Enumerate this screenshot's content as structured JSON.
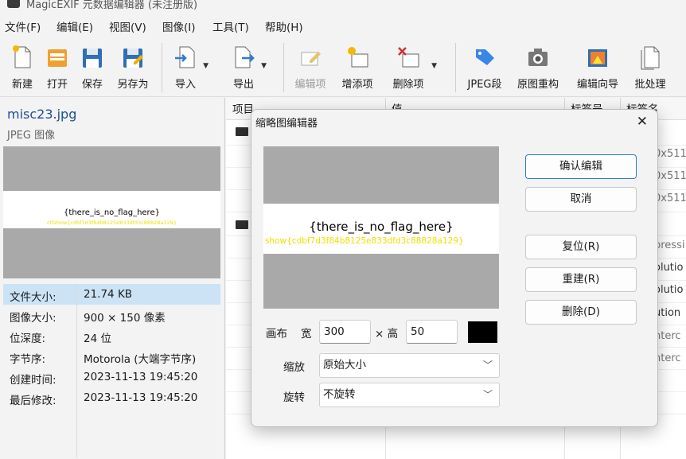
{
  "app": {
    "title": "MagicEXIF 元数据编辑器 (未注册版)"
  },
  "menu": [
    "文件(F)",
    "编辑(E)",
    "视图(V)",
    "图像(I)",
    "工具(T)",
    "帮助(H)"
  ],
  "toolbar": {
    "new": "新建",
    "open": "打开",
    "save": "保存",
    "save_as": "另存为",
    "import": "导入",
    "export": "导出",
    "edit_item": "编辑项",
    "add_item": "增添项",
    "delete_item": "删除项",
    "jpeg_segment": "JPEG段",
    "rebuild_image": "原图重构",
    "edit_wizard": "编辑向导",
    "batch": "批处理"
  },
  "file": {
    "name": "misc23.jpg",
    "type": "JPEG 图像",
    "preview_text": "{there_is_no_flag_here}",
    "preview_hidden_text": "ctfshow{cdbf7d3f84b8125e833dfd3c88828a129}",
    "properties": [
      {
        "label": "文件大小:",
        "value": "21.74 KB"
      },
      {
        "label": "图像大小:",
        "value": "900 × 150 像素"
      },
      {
        "label": "位深度:",
        "value": "24 位"
      },
      {
        "label": "字节序:",
        "value": "Motorola (大端字节序)"
      },
      {
        "label": "创建时间:",
        "value": "2023-11-13 19:45:20"
      },
      {
        "label": "最后修改:",
        "value": "2023-11-13 19:45:20"
      }
    ]
  },
  "table": {
    "columns": [
      "项目",
      "值",
      "标签号",
      "标签名"
    ],
    "right_values": [
      "0x511",
      "0x511",
      "0x511",
      "pressi",
      "olutio",
      "olutio",
      "ution",
      "nterc",
      "nterc"
    ]
  },
  "dialog": {
    "title": "缩略图编辑器",
    "close": "✕",
    "thumb_text": "{there_is_no_flag_here}",
    "thumb_hidden_text": "show{cdbf7d3f84b8125e833dfd3c88828a129}",
    "buttons": {
      "confirm": "确认编辑",
      "cancel": "取消",
      "reset": "复位(R)",
      "rebuild": "重建(R)",
      "delete": "删除(D)"
    },
    "canvas_label": "画布",
    "width_label": "宽",
    "width_value": "300",
    "height_label": "× 高",
    "height_value": "50",
    "canvas_color": "#000000",
    "scale_label": "缩放",
    "scale_value": "原始大小",
    "rotate_label": "旋转",
    "rotate_value": "不旋转"
  },
  "colors": {
    "accent": "#2b7bd0",
    "selection": "#cce3f6",
    "filename": "#1d4f91",
    "hidden_text": "#f0e000"
  }
}
